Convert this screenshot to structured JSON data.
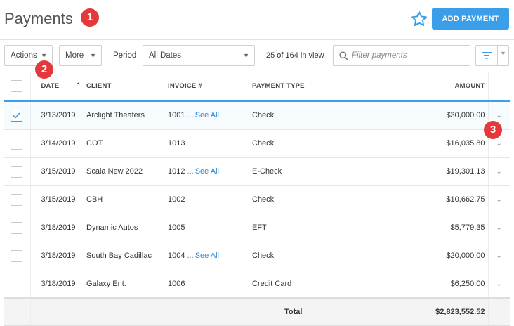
{
  "header": {
    "title": "Payments",
    "add_button": "ADD PAYMENT",
    "star_icon": "star-outline-icon"
  },
  "annotations": [
    "1",
    "2",
    "3"
  ],
  "toolbar": {
    "actions_label": "Actions",
    "more_label": "More",
    "period_label": "Period",
    "period_value": "All Dates",
    "count_text": "25 of 164 in view",
    "search_placeholder": "Filter payments"
  },
  "table": {
    "columns": [
      "DATE",
      "CLIENT",
      "INVOICE #",
      "PAYMENT TYPE",
      "AMOUNT"
    ],
    "see_all": "See All",
    "ellipsis": "...",
    "rows": [
      {
        "date": "3/13/2019",
        "client": "Arclight Theaters",
        "invoice": "1001",
        "multi": true,
        "type": "Check",
        "amount": "$30,000.00",
        "checked": true
      },
      {
        "date": "3/14/2019",
        "client": "COT",
        "invoice": "1013",
        "multi": false,
        "type": "Check",
        "amount": "$16,035.80",
        "checked": false
      },
      {
        "date": "3/15/2019",
        "client": "Scala New 2022",
        "invoice": "1012",
        "multi": true,
        "type": "E-Check",
        "amount": "$19,301.13",
        "checked": false
      },
      {
        "date": "3/15/2019",
        "client": "CBH",
        "invoice": "1002",
        "multi": false,
        "type": "Check",
        "amount": "$10,662.75",
        "checked": false
      },
      {
        "date": "3/18/2019",
        "client": "Dynamic Autos",
        "invoice": "1005",
        "multi": false,
        "type": "EFT",
        "amount": "$5,779.35",
        "checked": false
      },
      {
        "date": "3/18/2019",
        "client": "South Bay Cadillac",
        "invoice": "1004",
        "multi": true,
        "type": "Check",
        "amount": "$20,000.00",
        "checked": false
      },
      {
        "date": "3/18/2019",
        "client": "Galaxy Ent.",
        "invoice": "1006",
        "multi": false,
        "type": "Credit Card",
        "amount": "$6,250.00",
        "checked": false
      }
    ],
    "total_label": "Total",
    "total_value": "$2,823,552.52"
  },
  "colors": {
    "accent": "#3a9ee8",
    "badge": "#e5383b",
    "link": "#2f86d6"
  }
}
